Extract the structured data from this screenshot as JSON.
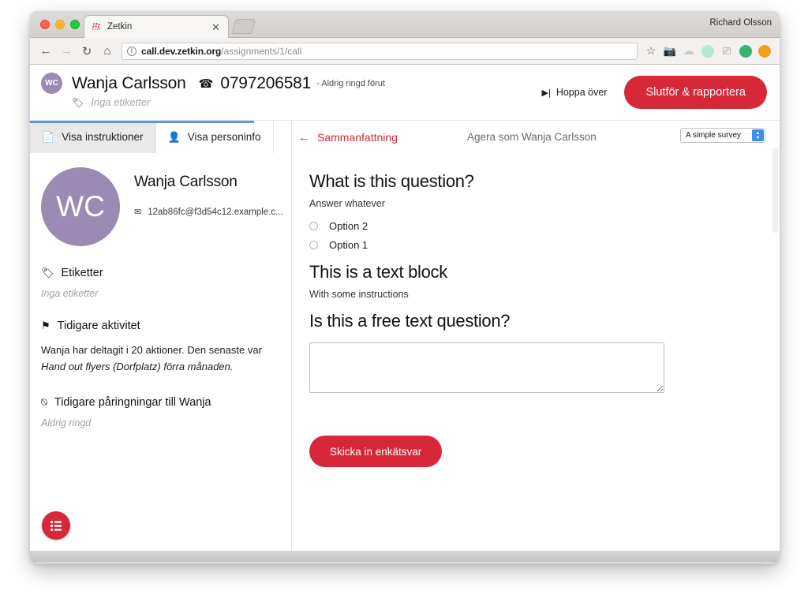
{
  "browser": {
    "tab": {
      "title": "Zetkin",
      "favicon_icon": "zetkin-favicon",
      "close_icon": "close-icon"
    },
    "new_tab_icon": "new-tab-icon",
    "profile_name": "Richard Olsson",
    "nav": {
      "back_icon": "back-arrow-icon",
      "forward_icon": "forward-arrow-icon",
      "reload_icon": "reload-icon",
      "home_icon": "home-icon"
    },
    "omnibox": {
      "info_icon": "page-info-icon",
      "url_host": "call.dev.zetkin.org",
      "url_path": "/assignments/1/call",
      "full_url": "call.dev.zetkin.org/assignments/1/call",
      "star_icon": "bookmark-star-icon"
    },
    "extensions": [
      {
        "name": "screenshot-extension-icon",
        "glyph": "▣"
      },
      {
        "name": "cloud-extension-icon",
        "glyph": "☁"
      },
      {
        "name": "mint-extension-icon",
        "glyph": ""
      },
      {
        "name": "cast-extension-icon",
        "glyph": "⎙"
      },
      {
        "name": "green-extension-icon",
        "glyph": ""
      },
      {
        "name": "orange-extension-icon",
        "glyph": ""
      }
    ]
  },
  "appbar": {
    "avatar_initials": "WC",
    "person_name": "Wanja Carlsson",
    "phone_icon": "phone-icon",
    "phone_number": "0797206581",
    "call_status": "- Aldrig ringd förut",
    "tag_icon": "tag-icon",
    "no_tags_label": "Inga etiketter",
    "skip_icon": "skip-next-icon",
    "skip_label": "Hoppa över",
    "finish_label": "Slutför & rapportera"
  },
  "left": {
    "tabs": [
      {
        "label": "Visa instruktioner",
        "icon": "document-icon",
        "active": false
      },
      {
        "label": "Visa personinfo",
        "icon": "person-icon",
        "active": true
      }
    ],
    "profile": {
      "avatar_initials": "WC",
      "name": "Wanja Carlsson",
      "mail_icon": "mail-icon",
      "email": "12ab86fc@f3d54c12.example.c..."
    },
    "tags_section": {
      "icon": "tag-icon",
      "title": "Etiketter",
      "empty": "Inga etiketter"
    },
    "activity_section": {
      "icon": "flag-icon",
      "title": "Tidigare aktivitet",
      "text_prefix": "Wanja har deltagit i 20 aktioner. Den senaste var ",
      "text_italic": "Hand out flyers (Dorfplatz) förra månaden."
    },
    "calls_section": {
      "icon": "clock-icon",
      "title": "Tidigare påringningar till Wanja",
      "empty": "Aldrig ringd"
    },
    "fab_icon": "list-menu-icon"
  },
  "right": {
    "back_arrow_icon": "left-arrow-icon",
    "summary_label": "Sammanfattning",
    "acting_as": "Agera som Wanja Carlsson",
    "survey_select": {
      "value": "A simple survey",
      "stepper_icon": "stepper-updown-icon"
    },
    "blocks": [
      {
        "type": "question",
        "title": "What is this question?",
        "description": "Answer whatever",
        "options": [
          {
            "label": "Option 2"
          },
          {
            "label": "Option 1"
          }
        ]
      },
      {
        "type": "text",
        "title": "This is a text block",
        "description": "With some instructions"
      },
      {
        "type": "freetext",
        "title": "Is this a free text question?",
        "value": "",
        "placeholder": ""
      }
    ],
    "submit_label": "Skicka in enkätsvar"
  },
  "colors": {
    "brand_red": "#d62839",
    "avatar_purple": "#9b8bb4",
    "tab_blue": "#5a9bd5",
    "stepper_blue": "#3b8ef0"
  }
}
